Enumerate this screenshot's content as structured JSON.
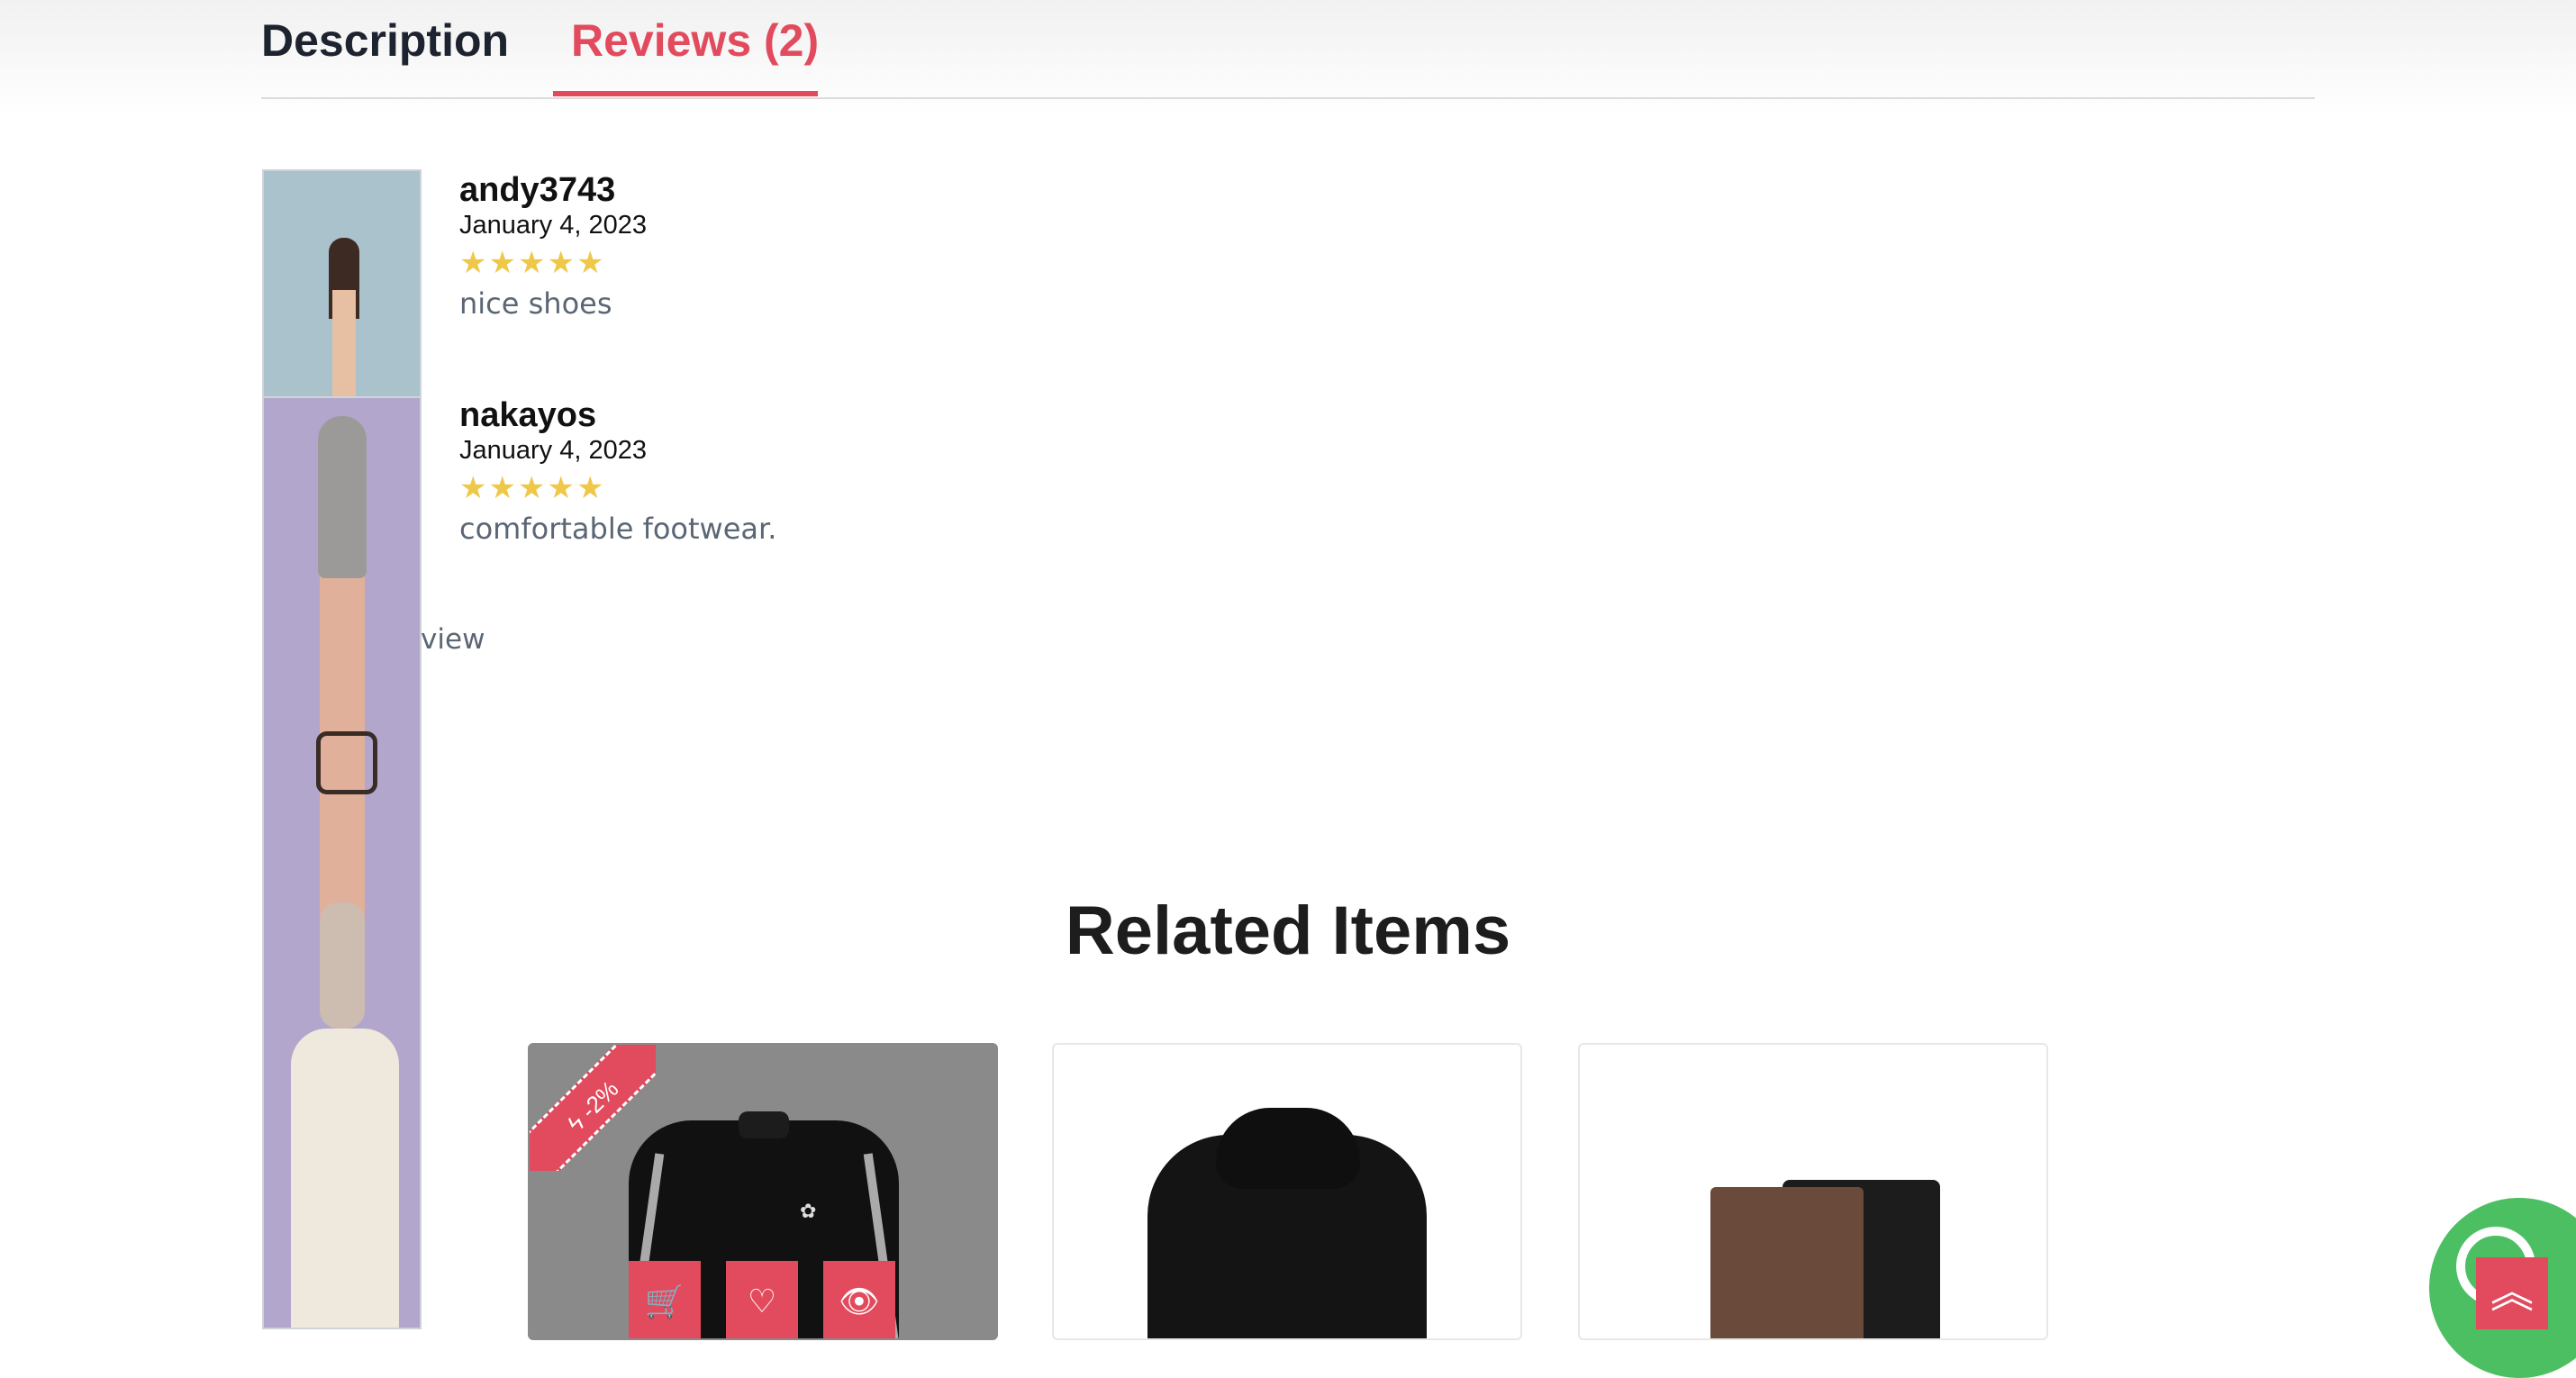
{
  "tabs": {
    "description": "Description",
    "reviews": "Reviews (2)"
  },
  "reviews": [
    {
      "author": "andy3743",
      "date": "January 4, 2023",
      "rating": 5,
      "text": "nice shoes"
    },
    {
      "author": "nakayos",
      "date": "January 4, 2023",
      "rating": 5,
      "text": "comfortable footwear."
    }
  ],
  "review_stars": {
    "icon": "star-icon",
    "glyph": "★"
  },
  "leave_review": "Leave a review",
  "related": {
    "title": "Related Items",
    "items": [
      {
        "name": "black track jacket",
        "badge": "-2%",
        "image": "jacket-image",
        "actions": [
          "cart-icon",
          "heart-icon",
          "eye-icon"
        ]
      },
      {
        "name": "black hoodie",
        "image": "hoodie-image"
      },
      {
        "name": "wallets",
        "image": "wallet-image"
      }
    ]
  },
  "floating": {
    "whatsapp_icon": "whatsapp-icon",
    "scroll_top_icon": "chevrons-up-icon",
    "scroll_top_glyph": "︽"
  },
  "colors": {
    "accent": "#e24a5d",
    "star": "#efc84a",
    "whatsapp": "#4cbf63",
    "text_muted": "#5b6675"
  }
}
